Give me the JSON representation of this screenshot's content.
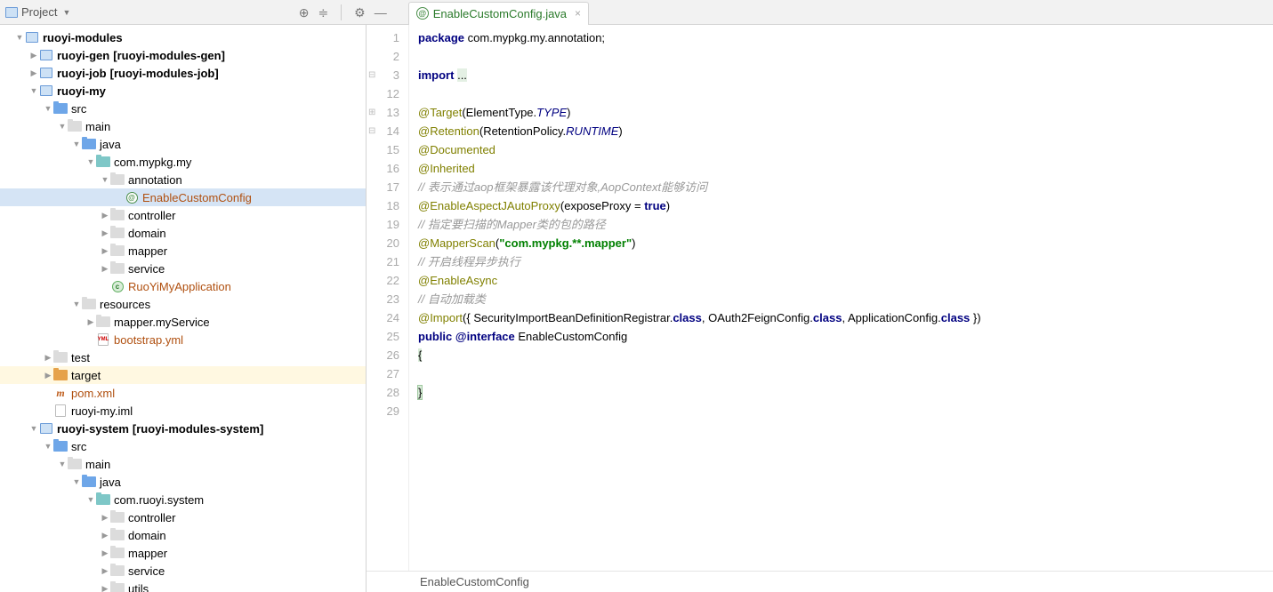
{
  "toolbar": {
    "project_label": "Project"
  },
  "tab": {
    "label": "EnableCustomConfig.java"
  },
  "tree": [
    {
      "d": 1,
      "a": "down",
      "i": "module",
      "t": "ruoyi-modules",
      "b": true
    },
    {
      "d": 2,
      "a": "right",
      "i": "module",
      "t": "ruoyi-gen",
      "suf": "[ruoyi-modules-gen]",
      "b": true
    },
    {
      "d": 2,
      "a": "right",
      "i": "module",
      "t": "ruoyi-job",
      "suf": "[ruoyi-modules-job]",
      "b": true
    },
    {
      "d": 2,
      "a": "down",
      "i": "module",
      "t": "ruoyi-my",
      "b": true
    },
    {
      "d": 3,
      "a": "down",
      "i": "folder-blue",
      "t": "src"
    },
    {
      "d": 4,
      "a": "down",
      "i": "folder-gray",
      "t": "main"
    },
    {
      "d": 5,
      "a": "down",
      "i": "folder-blue",
      "t": "java"
    },
    {
      "d": 6,
      "a": "down",
      "i": "folder-teal",
      "t": "com.mypkg.my"
    },
    {
      "d": 7,
      "a": "down",
      "i": "folder-gray",
      "t": "annotation"
    },
    {
      "d": 8,
      "a": "blank",
      "i": "at",
      "t": "EnableCustomConfig",
      "sel": true,
      "orange": true
    },
    {
      "d": 7,
      "a": "right",
      "i": "folder-gray",
      "t": "controller"
    },
    {
      "d": 7,
      "a": "right",
      "i": "folder-gray",
      "t": "domain"
    },
    {
      "d": 7,
      "a": "right",
      "i": "folder-gray",
      "t": "mapper"
    },
    {
      "d": 7,
      "a": "right",
      "i": "folder-gray",
      "t": "service"
    },
    {
      "d": 7,
      "a": "blank",
      "i": "class",
      "t": "RuoYiMyApplication",
      "orange": true
    },
    {
      "d": 5,
      "a": "down",
      "i": "folder-gray",
      "t": "resources"
    },
    {
      "d": 6,
      "a": "right",
      "i": "folder-gray",
      "t": "mapper.myService"
    },
    {
      "d": 6,
      "a": "blank",
      "i": "file-yml",
      "t": "bootstrap.yml",
      "orange": true
    },
    {
      "d": 3,
      "a": "right",
      "i": "folder-gray",
      "t": "test"
    },
    {
      "d": 3,
      "a": "right",
      "i": "folder-orange",
      "t": "target",
      "hl": true
    },
    {
      "d": 3,
      "a": "blank",
      "i": "m",
      "t": "pom.xml",
      "orange": true
    },
    {
      "d": 3,
      "a": "blank",
      "i": "file",
      "t": "ruoyi-my.iml"
    },
    {
      "d": 2,
      "a": "down",
      "i": "module",
      "t": "ruoyi-system",
      "suf": "[ruoyi-modules-system]",
      "b": true
    },
    {
      "d": 3,
      "a": "down",
      "i": "folder-blue",
      "t": "src"
    },
    {
      "d": 4,
      "a": "down",
      "i": "folder-gray",
      "t": "main"
    },
    {
      "d": 5,
      "a": "down",
      "i": "folder-blue",
      "t": "java"
    },
    {
      "d": 6,
      "a": "down",
      "i": "folder-teal",
      "t": "com.ruoyi.system"
    },
    {
      "d": 7,
      "a": "right",
      "i": "folder-gray",
      "t": "controller"
    },
    {
      "d": 7,
      "a": "right",
      "i": "folder-gray",
      "t": "domain"
    },
    {
      "d": 7,
      "a": "right",
      "i": "folder-gray",
      "t": "mapper"
    },
    {
      "d": 7,
      "a": "right",
      "i": "folder-gray",
      "t": "service"
    },
    {
      "d": 7,
      "a": "right",
      "i": "folder-gray",
      "t": "utils"
    }
  ],
  "code": {
    "gutter": [
      "1",
      "2",
      "3",
      "12",
      "13",
      "14",
      "15",
      "16",
      "17",
      "18",
      "19",
      "20",
      "21",
      "22",
      "23",
      "24",
      "25",
      "26",
      "27",
      "28",
      "29"
    ],
    "pkg": "package",
    "pkg_name": "com.mypkg.my.annotation",
    "imp": "import",
    "imp_rest": "...",
    "at_target": "@Target",
    "at_target_a": "(ElementType.",
    "at_target_b": "TYPE",
    "at_target_c": ")",
    "at_ret": "@Retention",
    "at_ret_a": "(RetentionPolicy.",
    "at_ret_b": "RUNTIME",
    "at_ret_c": ")",
    "at_doc": "@Documented",
    "at_inh": "@Inherited",
    "c1": "// 表示通过aop框架暴露该代理对象,AopContext能够访问",
    "at_proxy": "@EnableAspectJAutoProxy",
    "at_proxy_a": "(exposeProxy = ",
    "at_proxy_b": "true",
    "at_proxy_c": ")",
    "c2": "// 指定要扫描的Mapper类的包的路径",
    "at_scan": "@MapperScan",
    "at_scan_a": "(",
    "at_scan_s": "\"com.mypkg.**.mapper\"",
    "at_scan_c": ")",
    "c3": "// 开启线程异步执行",
    "at_async": "@EnableAsync",
    "c4": "// 自动加载类",
    "at_import": "@Import",
    "at_import_a": "({ SecurityImportBeanDefinitionRegistrar.",
    "at_import_cls": "class",
    "at_import_b": ", OAuth2FeignConfig.",
    "at_import_c": ", ApplicationConfig.",
    "at_import_d": " })",
    "pub": "public ",
    "iface": "@interface ",
    "cname": "EnableCustomConfig",
    "lb": "{",
    "rb": "}"
  },
  "breadcrumb": "EnableCustomConfig"
}
